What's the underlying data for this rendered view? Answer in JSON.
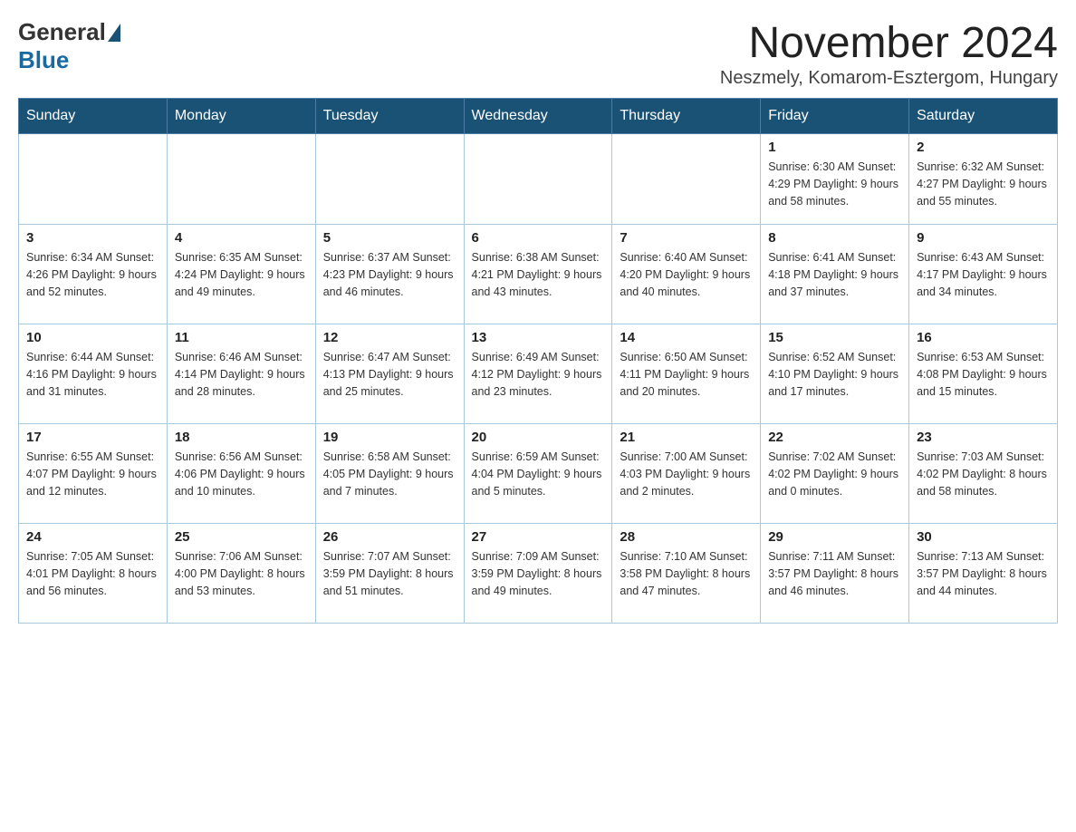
{
  "logo": {
    "general": "General",
    "blue": "Blue"
  },
  "title": "November 2024",
  "location": "Neszmely, Komarom-Esztergom, Hungary",
  "days_of_week": [
    "Sunday",
    "Monday",
    "Tuesday",
    "Wednesday",
    "Thursday",
    "Friday",
    "Saturday"
  ],
  "weeks": [
    [
      {
        "day": "",
        "info": ""
      },
      {
        "day": "",
        "info": ""
      },
      {
        "day": "",
        "info": ""
      },
      {
        "day": "",
        "info": ""
      },
      {
        "day": "",
        "info": ""
      },
      {
        "day": "1",
        "info": "Sunrise: 6:30 AM\nSunset: 4:29 PM\nDaylight: 9 hours and 58 minutes."
      },
      {
        "day": "2",
        "info": "Sunrise: 6:32 AM\nSunset: 4:27 PM\nDaylight: 9 hours and 55 minutes."
      }
    ],
    [
      {
        "day": "3",
        "info": "Sunrise: 6:34 AM\nSunset: 4:26 PM\nDaylight: 9 hours and 52 minutes."
      },
      {
        "day": "4",
        "info": "Sunrise: 6:35 AM\nSunset: 4:24 PM\nDaylight: 9 hours and 49 minutes."
      },
      {
        "day": "5",
        "info": "Sunrise: 6:37 AM\nSunset: 4:23 PM\nDaylight: 9 hours and 46 minutes."
      },
      {
        "day": "6",
        "info": "Sunrise: 6:38 AM\nSunset: 4:21 PM\nDaylight: 9 hours and 43 minutes."
      },
      {
        "day": "7",
        "info": "Sunrise: 6:40 AM\nSunset: 4:20 PM\nDaylight: 9 hours and 40 minutes."
      },
      {
        "day": "8",
        "info": "Sunrise: 6:41 AM\nSunset: 4:18 PM\nDaylight: 9 hours and 37 minutes."
      },
      {
        "day": "9",
        "info": "Sunrise: 6:43 AM\nSunset: 4:17 PM\nDaylight: 9 hours and 34 minutes."
      }
    ],
    [
      {
        "day": "10",
        "info": "Sunrise: 6:44 AM\nSunset: 4:16 PM\nDaylight: 9 hours and 31 minutes."
      },
      {
        "day": "11",
        "info": "Sunrise: 6:46 AM\nSunset: 4:14 PM\nDaylight: 9 hours and 28 minutes."
      },
      {
        "day": "12",
        "info": "Sunrise: 6:47 AM\nSunset: 4:13 PM\nDaylight: 9 hours and 25 minutes."
      },
      {
        "day": "13",
        "info": "Sunrise: 6:49 AM\nSunset: 4:12 PM\nDaylight: 9 hours and 23 minutes."
      },
      {
        "day": "14",
        "info": "Sunrise: 6:50 AM\nSunset: 4:11 PM\nDaylight: 9 hours and 20 minutes."
      },
      {
        "day": "15",
        "info": "Sunrise: 6:52 AM\nSunset: 4:10 PM\nDaylight: 9 hours and 17 minutes."
      },
      {
        "day": "16",
        "info": "Sunrise: 6:53 AM\nSunset: 4:08 PM\nDaylight: 9 hours and 15 minutes."
      }
    ],
    [
      {
        "day": "17",
        "info": "Sunrise: 6:55 AM\nSunset: 4:07 PM\nDaylight: 9 hours and 12 minutes."
      },
      {
        "day": "18",
        "info": "Sunrise: 6:56 AM\nSunset: 4:06 PM\nDaylight: 9 hours and 10 minutes."
      },
      {
        "day": "19",
        "info": "Sunrise: 6:58 AM\nSunset: 4:05 PM\nDaylight: 9 hours and 7 minutes."
      },
      {
        "day": "20",
        "info": "Sunrise: 6:59 AM\nSunset: 4:04 PM\nDaylight: 9 hours and 5 minutes."
      },
      {
        "day": "21",
        "info": "Sunrise: 7:00 AM\nSunset: 4:03 PM\nDaylight: 9 hours and 2 minutes."
      },
      {
        "day": "22",
        "info": "Sunrise: 7:02 AM\nSunset: 4:02 PM\nDaylight: 9 hours and 0 minutes."
      },
      {
        "day": "23",
        "info": "Sunrise: 7:03 AM\nSunset: 4:02 PM\nDaylight: 8 hours and 58 minutes."
      }
    ],
    [
      {
        "day": "24",
        "info": "Sunrise: 7:05 AM\nSunset: 4:01 PM\nDaylight: 8 hours and 56 minutes."
      },
      {
        "day": "25",
        "info": "Sunrise: 7:06 AM\nSunset: 4:00 PM\nDaylight: 8 hours and 53 minutes."
      },
      {
        "day": "26",
        "info": "Sunrise: 7:07 AM\nSunset: 3:59 PM\nDaylight: 8 hours and 51 minutes."
      },
      {
        "day": "27",
        "info": "Sunrise: 7:09 AM\nSunset: 3:59 PM\nDaylight: 8 hours and 49 minutes."
      },
      {
        "day": "28",
        "info": "Sunrise: 7:10 AM\nSunset: 3:58 PM\nDaylight: 8 hours and 47 minutes."
      },
      {
        "day": "29",
        "info": "Sunrise: 7:11 AM\nSunset: 3:57 PM\nDaylight: 8 hours and 46 minutes."
      },
      {
        "day": "30",
        "info": "Sunrise: 7:13 AM\nSunset: 3:57 PM\nDaylight: 8 hours and 44 minutes."
      }
    ]
  ]
}
